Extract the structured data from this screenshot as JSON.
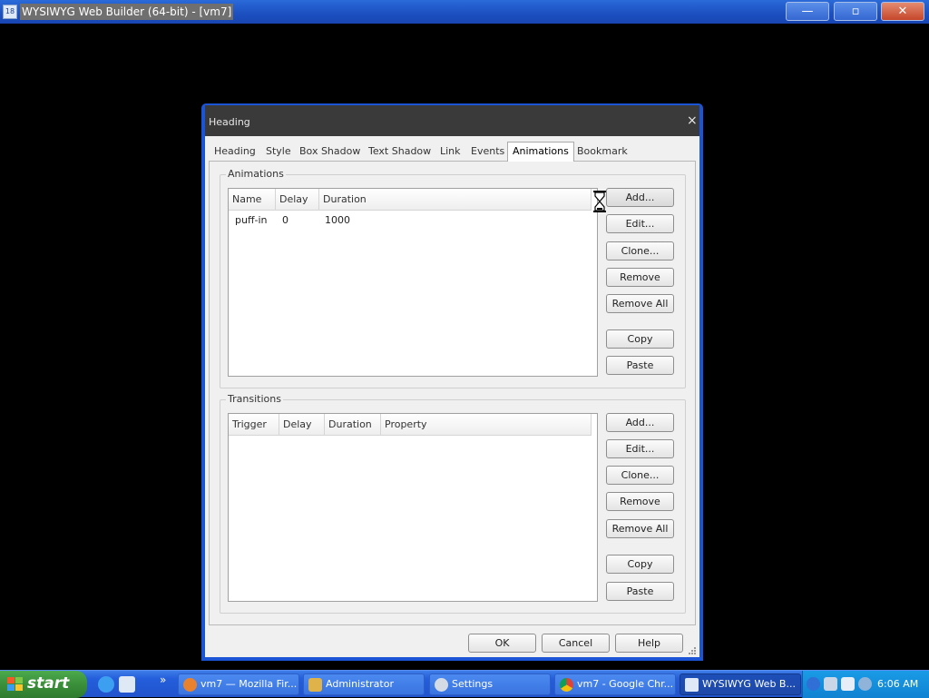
{
  "app": {
    "title": "WYSIWYG Web Builder (64-bit) - [vm7]",
    "icon_text": "18",
    "minimize": "—",
    "maximize": "▫",
    "close": "✕"
  },
  "dialog": {
    "title": "Heading",
    "close": "×",
    "tabs": [
      "Heading",
      "Style",
      "Box Shadow",
      "Text Shadow",
      "Link",
      "Events",
      "Animations",
      "Bookmark"
    ],
    "active_tab": "Animations",
    "animations": {
      "label": "Animations",
      "columns": [
        "Name",
        "Delay",
        "Duration"
      ],
      "rows": [
        {
          "name": "puff-in",
          "delay": "0",
          "duration": "1000"
        }
      ],
      "buttons": {
        "add": "Add...",
        "edit": "Edit...",
        "clone": "Clone...",
        "remove": "Remove",
        "remove_all": "Remove All",
        "copy": "Copy",
        "paste": "Paste"
      }
    },
    "transitions": {
      "label": "Transitions",
      "columns": [
        "Trigger",
        "Delay",
        "Duration",
        "Property"
      ],
      "buttons": {
        "add": "Add...",
        "edit": "Edit...",
        "clone": "Clone...",
        "remove": "Remove",
        "remove_all": "Remove All",
        "copy": "Copy",
        "paste": "Paste"
      }
    },
    "footer": {
      "ok": "OK",
      "cancel": "Cancel",
      "help": "Help"
    }
  },
  "taskbar": {
    "start": "start",
    "more": "»",
    "tasks": [
      {
        "label": "vm7 — Mozilla Fir...",
        "icon": "firefox-icon"
      },
      {
        "label": "Administrator",
        "icon": "users-icon"
      },
      {
        "label": "Settings",
        "icon": "gear-icon"
      },
      {
        "label": "vm7 - Google Chr...",
        "icon": "chrome-icon"
      },
      {
        "label": "WYSIWYG Web B...",
        "icon": "wysiwyg-icon"
      }
    ],
    "clock": "6:06 AM"
  },
  "colors": {
    "dialog_border": "#1b55d6",
    "taskbar": "#245edb",
    "start": "#3a8f3a"
  }
}
